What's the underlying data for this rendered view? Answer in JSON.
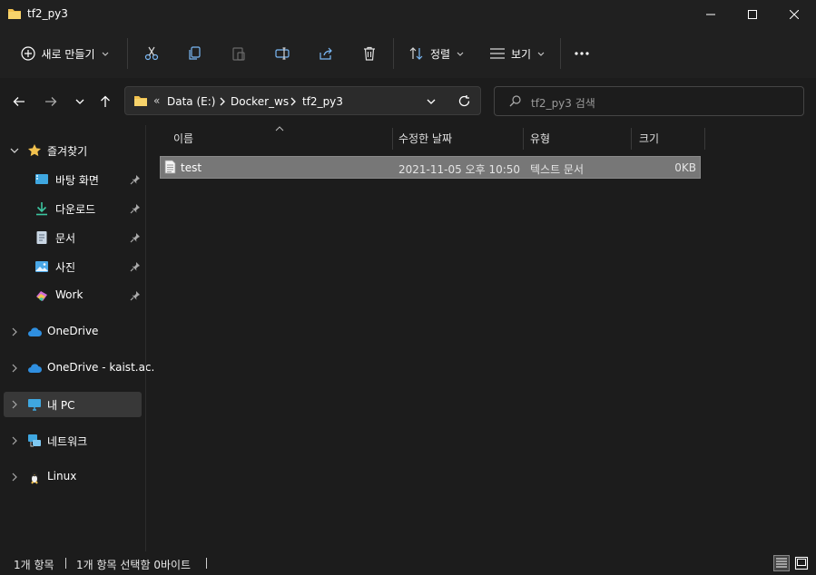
{
  "window": {
    "title": "tf2_py3",
    "controls": [
      "minimize-icon",
      "maximize-icon",
      "close-icon"
    ]
  },
  "toolbar": {
    "new_label": "새로 만들기",
    "sort_label": "정렬",
    "view_label": "보기",
    "icons": [
      "cut-icon",
      "copy-icon",
      "paste-icon",
      "rename-icon",
      "share-icon",
      "delete-icon",
      "more-icon"
    ]
  },
  "address": {
    "overflow": "«",
    "crumbs": [
      "Data (E:)",
      "Docker_ws",
      "tf2_py3"
    ]
  },
  "search": {
    "placeholder": "tf2_py3 검색"
  },
  "sidebar": {
    "quick_access": "즐겨찾기",
    "items": [
      {
        "label": "바탕 화면",
        "icon": "desktop-icon",
        "pinned": true
      },
      {
        "label": "다운로드",
        "icon": "download-icon",
        "pinned": true
      },
      {
        "label": "문서",
        "icon": "document-icon",
        "pinned": true
      },
      {
        "label": "사진",
        "icon": "pictures-icon",
        "pinned": true
      },
      {
        "label": "Work",
        "icon": "work-folder-icon",
        "pinned": true
      }
    ],
    "roots": [
      {
        "label": "OneDrive",
        "icon": "cloud-icon"
      },
      {
        "label": "OneDrive - kaist.ac.",
        "icon": "cloud-icon"
      },
      {
        "label": "내 PC",
        "icon": "monitor-icon",
        "selected": true
      },
      {
        "label": "네트워크",
        "icon": "network-icon"
      },
      {
        "label": "Linux",
        "icon": "linux-icon"
      }
    ]
  },
  "columns": {
    "name": "이름",
    "modified": "수정한 날짜",
    "type": "유형",
    "size": "크기"
  },
  "files": [
    {
      "name": "test",
      "modified": "2021-11-05 오후 10:50",
      "type": "텍스트 문서",
      "size": "0KB",
      "selected": true
    }
  ],
  "status": {
    "count": "1개 항목",
    "selection": "1개 항목 선택함 0바이트"
  },
  "colors": {
    "background": "#1c1c1c",
    "chrome": "#202020",
    "selected_row": "#777777",
    "folder": "#f2c14e",
    "accent": "#4aa8e8"
  }
}
